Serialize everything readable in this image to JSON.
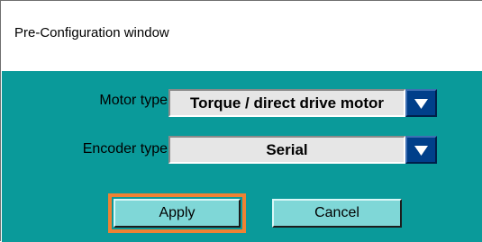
{
  "window": {
    "title": "Pre-Configuration window"
  },
  "motor_type": {
    "label": "Motor type",
    "selected": "Torque / direct drive motor"
  },
  "encoder_type": {
    "label": "Encoder type",
    "selected": "Serial"
  },
  "buttons": {
    "apply_label": "Apply",
    "cancel_label": "Cancel"
  },
  "colors": {
    "client_background": "#0a9a9a",
    "dropdown_arrow_background": "#003f8a",
    "button_face": "#7fd7d7",
    "focus_outline": "#ef8233"
  },
  "icons": {
    "dropdown": "chevron-down-icon"
  }
}
